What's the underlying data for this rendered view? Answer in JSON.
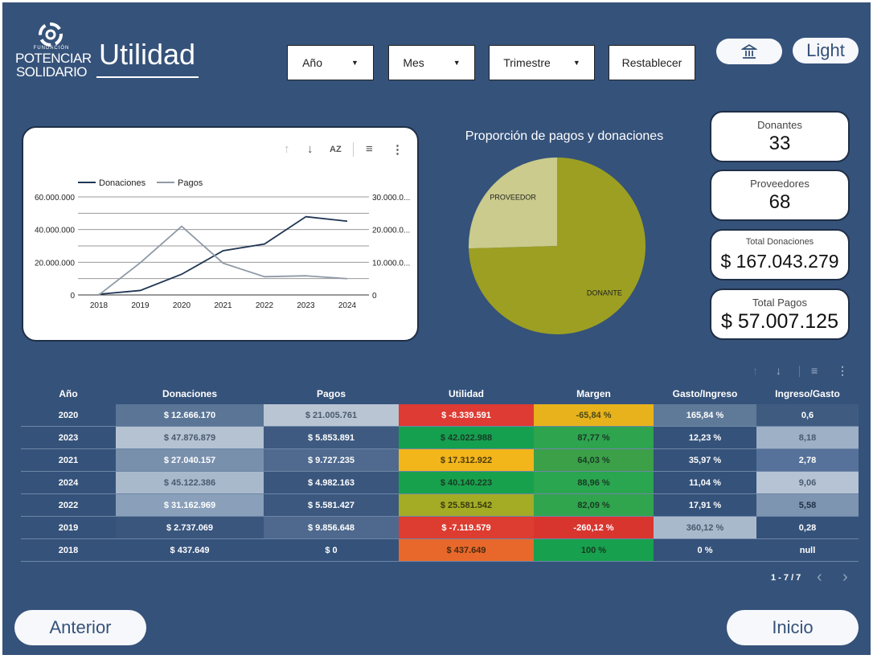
{
  "header": {
    "logo": {
      "small": "FUNDACIÓN",
      "line1": "POTENCIAR",
      "line2": "SOLIDARIO"
    },
    "title": "Utilidad",
    "filters": [
      {
        "label": "Año",
        "caret": "▼"
      },
      {
        "label": "Mes",
        "caret": "▼"
      },
      {
        "label": "Trimestre",
        "caret": "▼"
      }
    ],
    "reset_label": "Restablecer",
    "theme_label": "Light"
  },
  "line_chart": {
    "toolbar": {
      "sort_up": "↑",
      "sort_down": "↓",
      "sort_az": "AZ",
      "filter": "≡",
      "more": "⋮"
    },
    "chart_data": {
      "type": "line",
      "x": [
        "2018",
        "2019",
        "2020",
        "2021",
        "2022",
        "2023",
        "2024"
      ],
      "series": [
        {
          "name": "Donaciones",
          "axis": "left",
          "color": "#1f3553",
          "values": [
            437649,
            2737069,
            12666170,
            27040157,
            31162969,
            47876879,
            45122386
          ]
        },
        {
          "name": "Pagos",
          "axis": "right",
          "color": "#8f9aa7",
          "values": [
            0,
            9856648,
            21005761,
            9727235,
            5581427,
            5853891,
            4982163
          ]
        }
      ],
      "left_ticks": [
        "60.000.000",
        "40.000.000",
        "20.000.000",
        "0"
      ],
      "right_ticks": [
        "30.000.0...",
        "20.000.0...",
        "10.000.0...",
        "0"
      ],
      "ylim_left": [
        0,
        60000000
      ],
      "ylim_right": [
        0,
        30000000
      ],
      "legend_position": "top-left",
      "grid": true
    }
  },
  "pie_chart": {
    "title": "Proporción de pagos y donaciones",
    "chart_data": {
      "type": "pie",
      "slices": [
        {
          "label": "DONANTE",
          "value": 167043279,
          "color": "#9c9f22"
        },
        {
          "label": "PROVEEDOR",
          "value": 57007125,
          "color": "#cacb8c"
        }
      ]
    }
  },
  "kpis": [
    {
      "label": "Donantes",
      "value": "33"
    },
    {
      "label": "Proveedores",
      "value": "68"
    },
    {
      "label": "Total Donaciones",
      "value": "$ 167.043.279"
    },
    {
      "label": "Total Pagos",
      "value": "$ 57.007.125"
    }
  ],
  "table": {
    "toolbar": {
      "sort_up": "↑",
      "sort_down": "↓",
      "filter": "≡",
      "more": "⋮"
    },
    "headers": [
      "Año",
      "Donaciones",
      "Pagos",
      "Utilidad",
      "Margen",
      "Gasto/Ingreso",
      "Ingreso/Gasto"
    ],
    "rows": [
      {
        "cells": [
          "2020",
          "$ 12.666.170",
          "$ 21.005.761",
          "$ -8.339.591",
          "-65,84 %",
          "165,84 %",
          "0,6"
        ],
        "bg": [
          "#35527a",
          "#5a7596",
          "#b9c5d3",
          "#dd3b33",
          "#e7b21b",
          "#5f7a99",
          "#3f5b80"
        ],
        "fg": [
          "#ffffff",
          "#ffffff",
          "#4a5a6e",
          "#ffffff",
          "#4a4a1a",
          "#ffffff",
          "#ffffff"
        ]
      },
      {
        "cells": [
          "2023",
          "$ 47.876.879",
          "$ 5.853.891",
          "$ 42.022.988",
          "87,77 %",
          "12,23 %",
          "8,18"
        ],
        "bg": [
          "#35527a",
          "#b4c2d2",
          "#3e5a80",
          "#15a050",
          "#2ea44f",
          "#35527a",
          "#9eb0c6"
        ],
        "fg": [
          "#ffffff",
          "#4a5a6e",
          "#ffffff",
          "#1a3a25",
          "#1a3a25",
          "#ffffff",
          "#4a5a6e"
        ]
      },
      {
        "cells": [
          "2021",
          "$ 27.040.157",
          "$ 9.727.235",
          "$ 17.312.922",
          "64,03 %",
          "35,97 %",
          "2,78"
        ],
        "bg": [
          "#35527a",
          "#7990ad",
          "#4f6a8e",
          "#f2b51a",
          "#3ba048",
          "#35527a",
          "#56729a"
        ],
        "fg": [
          "#ffffff",
          "#ffffff",
          "#ffffff",
          "#4a3a10",
          "#1a3a25",
          "#ffffff",
          "#ffffff"
        ]
      },
      {
        "cells": [
          "2024",
          "$ 45.122.386",
          "$ 4.982.163",
          "$ 40.140.223",
          "88,96 %",
          "11,04 %",
          "9,06"
        ],
        "bg": [
          "#35527a",
          "#a9b9cc",
          "#3a567d",
          "#18a14c",
          "#2aa650",
          "#35527a",
          "#b5c3d4"
        ],
        "fg": [
          "#ffffff",
          "#4a5a6e",
          "#ffffff",
          "#1a3a25",
          "#1a3a25",
          "#ffffff",
          "#4a5a6e"
        ]
      },
      {
        "cells": [
          "2022",
          "$ 31.162.969",
          "$ 5.581.427",
          "$ 25.581.542",
          "82,09 %",
          "17,91 %",
          "5,58"
        ],
        "bg": [
          "#35527a",
          "#8aa0ba",
          "#3c587f",
          "#a3ac24",
          "#31a44e",
          "#35527a",
          "#7e95b1"
        ],
        "fg": [
          "#ffffff",
          "#ffffff",
          "#ffffff",
          "#3a3a10",
          "#1a3a25",
          "#ffffff",
          "#1f2f47"
        ]
      },
      {
        "cells": [
          "2019",
          "$ 2.737.069",
          "$ 9.856.648",
          "$ -7.119.579",
          "-260,12 %",
          "360,12 %",
          "0,28"
        ],
        "bg": [
          "#35527a",
          "#3a567d",
          "#4e698d",
          "#dd3c30",
          "#d9352f",
          "#a9b9cc",
          "#35527a"
        ],
        "fg": [
          "#ffffff",
          "#ffffff",
          "#ffffff",
          "#ffffff",
          "#ffffff",
          "#4a5a6e",
          "#ffffff"
        ]
      },
      {
        "cells": [
          "2018",
          "$ 437.649",
          "$ 0",
          "$ 437.649",
          "100 %",
          "0 %",
          "null"
        ],
        "bg": [
          "#35527a",
          "#35527a",
          "#35527a",
          "#e8682b",
          "#17a04d",
          "#35527a",
          "#35527a"
        ],
        "fg": [
          "#ffffff",
          "#ffffff",
          "#ffffff",
          "#4a2a10",
          "#1a3a25",
          "#ffffff",
          "#ffffff"
        ]
      }
    ],
    "pager": {
      "text": "1 - 7 / 7",
      "prev": "‹",
      "next": "›"
    }
  },
  "nav": {
    "prev_label": "Anterior",
    "home_label": "Inicio"
  },
  "colors": {
    "background": "#35527a",
    "card": "#ffffff",
    "accent_dark": "#1f2f47"
  }
}
